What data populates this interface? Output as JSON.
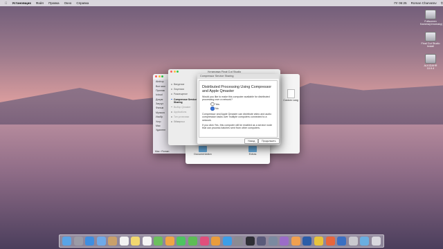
{
  "menubar": {
    "apple": "",
    "app": "Установщик",
    "items": [
      "Файл",
      "Правка",
      "Окно",
      "Справка"
    ],
    "clock": "Пт 06:25",
    "user": "Roman Charvatov"
  },
  "desktop_icons": [
    {
      "label": "Fullscreen Kamera(chromaky)"
    },
    {
      "label": "Final Cut Studio Install"
    },
    {
      "label": "ALKIDAHR 10.9.4"
    }
  ],
  "finder": {
    "sidebar": [
      "Airdrop",
      "Все мои",
      "Прилож",
      "Icloud",
      "Докум",
      "Загруз",
      "Фильм",
      "Музыка",
      "Изобр",
      "Устр",
      "Mac",
      "Удаленн"
    ],
    "status": "Mac › Roman",
    "file_label": "Custom Lang",
    "folders": [
      "Documentation",
      "Extras"
    ]
  },
  "installer": {
    "title": "Установка Final Cut Studio",
    "steps": [
      "Введение",
      "Лицензия",
      "Размещение",
      "Compressor Service Sharing",
      "Выбор Qmaster",
      "Applications",
      "Тип установки",
      "Установка",
      "Обзор"
    ]
  },
  "sheet": {
    "title": "Compressor Service Sharing",
    "heading": "Distributed Processing Using Compressor and Apple Qmaster",
    "question": "Would you like to make this computer available for distributed processing over a network?",
    "options": [
      "Yes",
      "No"
    ],
    "selected": "No",
    "info1": "Compressor and Apple Qmaster can distribute video and audio compression tasks over multiple computers connected to a network.",
    "info2": "If you click Yes, this computer will be enabled as a service node that can process batches sent from other computers.",
    "back_button": "Назад",
    "continue_button": "Продолжить"
  },
  "dock": {
    "apps": [
      "finder",
      "launchpad",
      "safari",
      "mail",
      "contacts",
      "calendar",
      "notes",
      "reminders",
      "maps",
      "photos",
      "messages",
      "facetime",
      "itunes",
      "ibooks",
      "appstore",
      "systemprefs",
      "finalcut",
      "motion",
      "compressor",
      "imovie",
      "garageband",
      "photoshop",
      "chrome",
      "firefox",
      "quicktime",
      "installer",
      "downloads",
      "trash"
    ],
    "colors": [
      "#5aa4e6",
      "#9b9ba6",
      "#3f8ee0",
      "#6fa9e8",
      "#c9a06a",
      "#f2f2f2",
      "#f1d870",
      "#f5f5f5",
      "#6cbf5e",
      "#f0a545",
      "#4dc461",
      "#5dbd55",
      "#e04f7c",
      "#e99c3c",
      "#3c9ee8",
      "#8b8b93",
      "#2f2f36",
      "#5a5a7a",
      "#7b8aa0",
      "#9b6cc8",
      "#f0a050",
      "#2b5da8",
      "#e8c33c",
      "#e8663c",
      "#3b6fc2",
      "#c9c9cf",
      "#6aaee0",
      "#d8d8de"
    ]
  }
}
